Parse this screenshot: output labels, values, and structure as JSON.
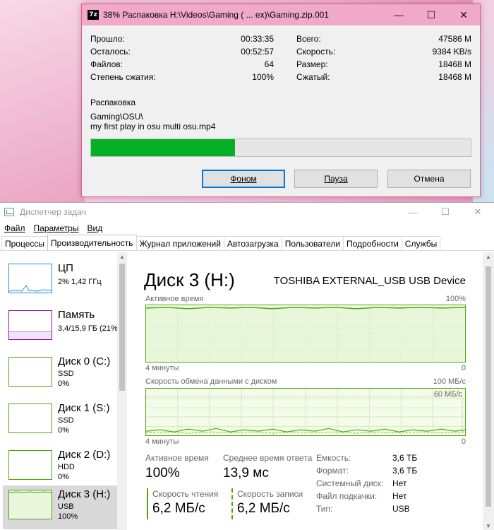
{
  "zip": {
    "title": "38% Распаковка H:\\Videos\\Gaming ( ... ex)\\Gaming.zip.001",
    "logo": "7z",
    "stats_left": [
      {
        "label": "Прошло:",
        "value": "00:33:35"
      },
      {
        "label": "Осталось:",
        "value": "00:52:57"
      },
      {
        "label": "Файлов:",
        "value": "64"
      },
      {
        "label": "Степень сжатия:",
        "value": "100%"
      }
    ],
    "stats_right": [
      {
        "label": "Всего:",
        "value": "47586 M"
      },
      {
        "label": "Скорость:",
        "value": "9384 KB/s"
      },
      {
        "label": "Размер:",
        "value": "18468 M"
      },
      {
        "label": "Сжатый:",
        "value": "18468 M"
      }
    ],
    "action": "Распаковка",
    "path_line1": "Gaming\\OSU\\",
    "path_line2": "my first play in osu multi osu.mp4",
    "progress_fraction": 0.38,
    "buttons": {
      "background": "Фоном",
      "pause": "Пауза",
      "cancel": "Отмена"
    }
  },
  "tm": {
    "title": "Диспетчер задач",
    "menu": [
      "Файл",
      "Параметры",
      "Вид"
    ],
    "tabs": [
      "Процессы",
      "Производительность",
      "Журнал приложений",
      "Автозагрузка",
      "Пользователи",
      "Подробности",
      "Службы"
    ],
    "side": [
      {
        "name": "ЦП",
        "sub1": "2% 1,42 ГГц",
        "sub2": ""
      },
      {
        "name": "Память",
        "sub1": "3,4/15,9 ГБ (21%)",
        "sub2": ""
      },
      {
        "name": "Диск 0 (C:)",
        "sub1": "SSD",
        "sub2": "0%"
      },
      {
        "name": "Диск 1 (S:)",
        "sub1": "SSD",
        "sub2": "0%"
      },
      {
        "name": "Диск 2 (D:)",
        "sub1": "HDD",
        "sub2": "0%"
      },
      {
        "name": "Диск 3 (H:)",
        "sub1": "USB",
        "sub2": "100%"
      }
    ],
    "disk_title": "Диск 3 (H:)",
    "device": "TOSHIBA EXTERNAL_USB USB Device",
    "graph1": {
      "label": "Активное время",
      "max": "100%",
      "time": "4 минуты",
      "min": "0"
    },
    "graph2": {
      "label": "Скорость обмена данными с диском",
      "max": "100 МБ/с",
      "inner": "60 МБ/с",
      "time": "4 минуты",
      "min": "0"
    },
    "active_time": {
      "label": "Активное время",
      "value": "100%"
    },
    "resp_time": {
      "label": "Среднее время ответа",
      "value": "13,9 мс"
    },
    "read": {
      "label": "Скорость чтения",
      "value": "6,2 МБ/с"
    },
    "write": {
      "label": "Скорость записи",
      "value": "6,2 МБ/с"
    },
    "props": [
      {
        "label": "Емкость:",
        "value": "3,6 ТБ"
      },
      {
        "label": "Формат:",
        "value": "3,6 ТБ"
      },
      {
        "label": "Системный диск:",
        "value": "Нет"
      },
      {
        "label": "Файл подкачки:",
        "value": "Нет"
      },
      {
        "label": "Тип:",
        "value": "USB"
      }
    ],
    "colors": {
      "accent": "#4da60c",
      "cpu": "#1b90d6",
      "memory": "#8b12ae"
    }
  }
}
